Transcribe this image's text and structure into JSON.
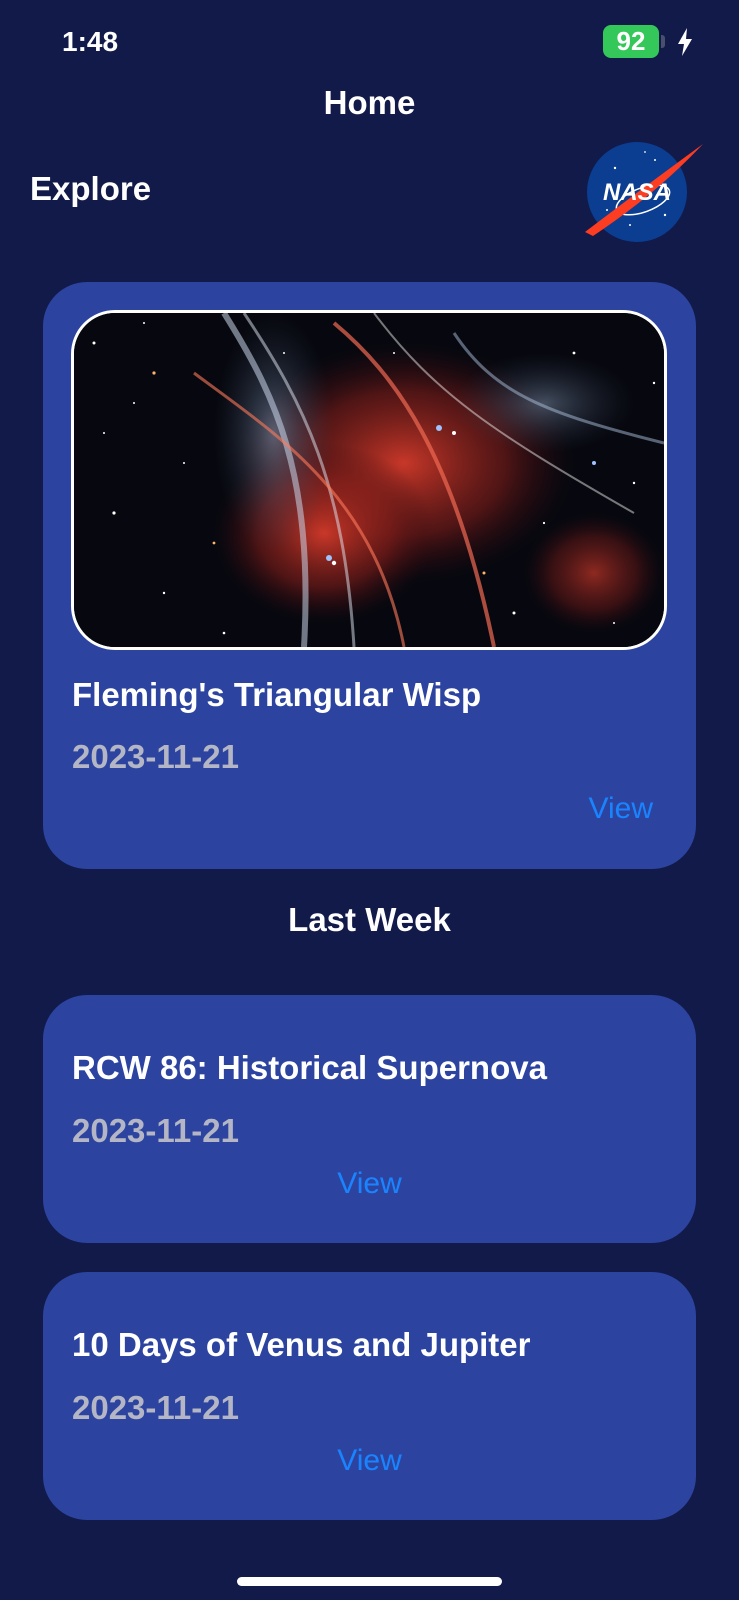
{
  "status_bar": {
    "time": "1:48",
    "battery_level": "92",
    "battery_color": "#34c759",
    "charging_icon": "bolt-icon"
  },
  "nav": {
    "title": "Home"
  },
  "explore": {
    "title": "Explore",
    "logo_text": "NASA",
    "logo_icon": "nasa-meatball-logo"
  },
  "featured": {
    "title": "Fleming's Triangular Wisp",
    "date": "2023-11-21",
    "view_label": "View",
    "image_icon": "nebula-photo"
  },
  "last_week": {
    "title": "Last Week",
    "items": [
      {
        "title": "RCW 86: Historical Supernova",
        "date": "2023-11-21",
        "view_label": "View"
      },
      {
        "title": "10 Days of Venus and Jupiter",
        "date": "2023-11-21",
        "view_label": "View"
      }
    ]
  },
  "colors": {
    "background": "#121a4a",
    "card": "#2c44a0",
    "link": "#1a84ff",
    "date_text": "#b4b6c6"
  }
}
